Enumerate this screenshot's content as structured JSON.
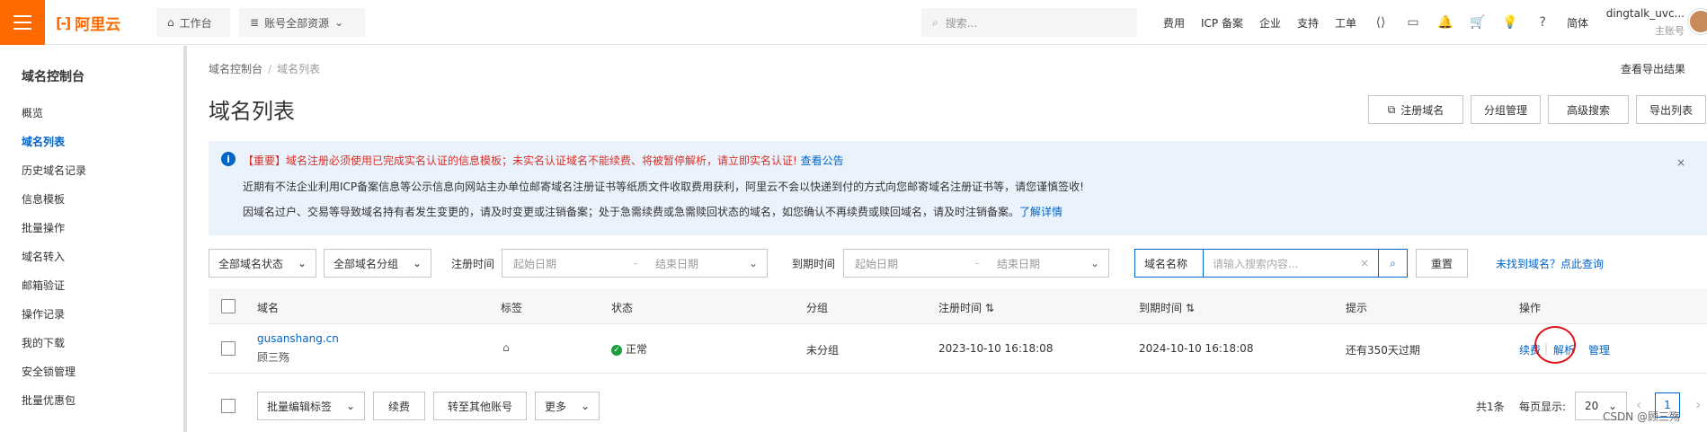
{
  "header": {
    "logo_text": "阿里云",
    "workbench": "工作台",
    "resources": "账号全部资源",
    "search_placeholder": "搜索...",
    "nav": [
      "费用",
      "ICP 备案",
      "企业",
      "支持",
      "工单"
    ],
    "lang": "简体",
    "user_name": "dingtalk_uvc...",
    "user_role": "主账号"
  },
  "sidebar": {
    "title": "域名控制台",
    "items": [
      "概览",
      "域名列表",
      "历史域名记录",
      "信息模板",
      "批量操作",
      "域名转入",
      "邮箱验证",
      "操作记录",
      "我的下载",
      "安全锁管理",
      "批量优惠包"
    ],
    "active_index": 1
  },
  "breadcrumb": {
    "root": "域名控制台",
    "current": "域名列表"
  },
  "export_result": "查看导出结果",
  "page_title": "域名列表",
  "actions": {
    "register": "注册域名",
    "group": "分组管理",
    "advanced": "高级搜索",
    "export": "导出列表"
  },
  "notice": {
    "line1": "【重要】域名注册必须使用已完成实名认证的信息模板；未实名认证域名不能续费、将被暂停解析，请立即实名认证!",
    "line1_link": "查看公告",
    "line2": "近期有不法企业利用ICP备案信息等公示信息向网站主办单位邮寄域名注册证书等纸质文件收取费用获利，阿里云不会以快递到付的方式向您邮寄域名注册证书等，请您谨慎签收!",
    "line3": "因域名过户、交易等导致域名持有者发生变更的，请及时变更或注销备案；处于急需续费或急需赎回状态的域名，如您确认不再续费或赎回域名，请及时注销备案。",
    "line3_link": "了解详情"
  },
  "filters": {
    "status": "全部域名状态",
    "group": "全部域名分组",
    "reg_label": "注册时间",
    "exp_label": "到期时间",
    "start_ph": "起始日期",
    "end_ph": "结束日期",
    "search_type": "域名名称",
    "search_ph": "请输入搜索内容...",
    "reset": "重置",
    "not_found": "未找到域名？点此查询"
  },
  "table": {
    "headers": [
      "域名",
      "标签",
      "状态",
      "分组",
      "注册时间",
      "到期时间",
      "提示",
      "操作"
    ],
    "rows": [
      {
        "domain": "gusanshang.cn",
        "owner": "顾三殇",
        "status": "正常",
        "group": "未分组",
        "reg_time": "2023-10-10 16:18:08",
        "exp_time": "2024-10-10 16:18:08",
        "tip": "还有350天过期",
        "ops": [
          "续费",
          "解析",
          "管理"
        ]
      }
    ]
  },
  "bulk": {
    "edit_tag": "批量编辑标签",
    "renew": "续费",
    "transfer": "转至其他账号",
    "more": "更多"
  },
  "pager": {
    "total": "共1条",
    "per_page_label": "每页显示:",
    "per_page": "20",
    "current": "1"
  },
  "watermark": "CSDN @顾三殇"
}
